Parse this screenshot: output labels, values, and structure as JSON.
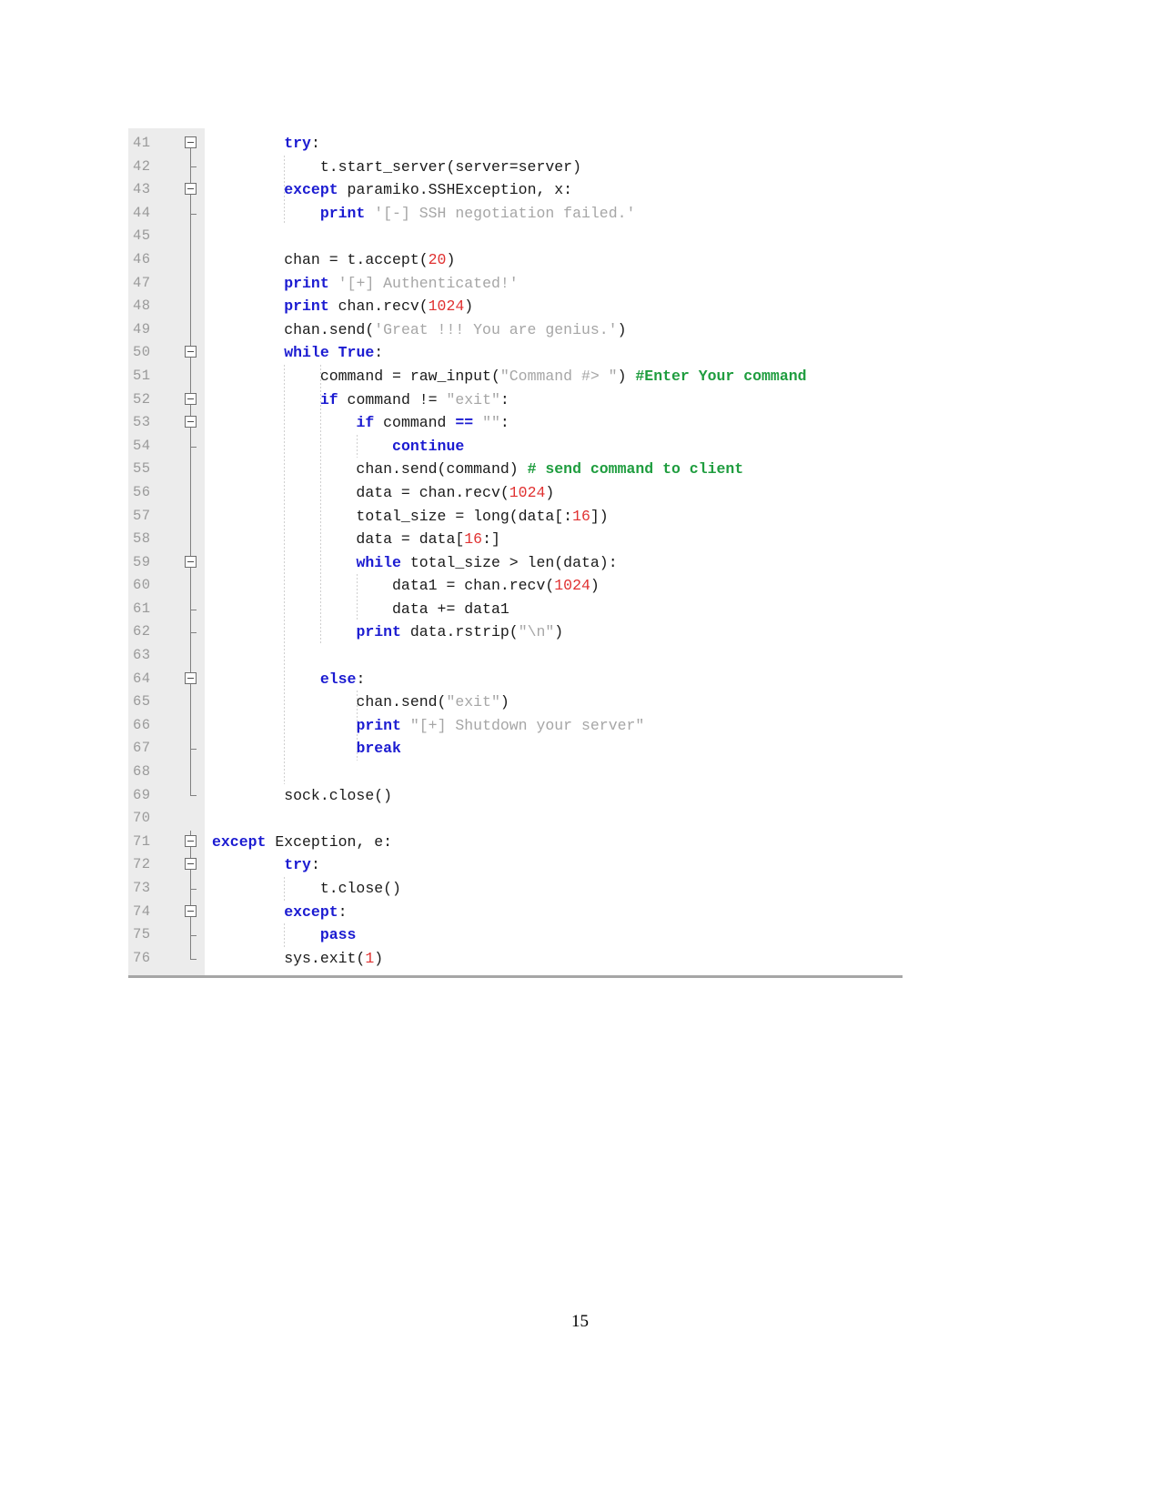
{
  "document": {
    "page_number": "15",
    "figure_name": "python-ssh-server-code-screenshot"
  },
  "editor": {
    "theme": {
      "background": "#ffffff",
      "gutter_background": "#ececec",
      "line_number_color": "#9a9a9a",
      "keyword_color": "#1b1bd1",
      "string_color": "#a6a6a6",
      "number_color": "#e03131",
      "comment_color": "#1f9d3f",
      "plain_color": "#1a1a1a",
      "fold_marker_color": "#6e6e6e"
    },
    "first_line_number": 41,
    "last_line_number": 76,
    "lines": [
      {
        "number": "41",
        "fold": "box",
        "tokens": [
          {
            "t": "        ",
            "c": "pl"
          },
          {
            "t": "try",
            "c": "kw"
          },
          {
            "t": ":",
            "c": "pl"
          }
        ]
      },
      {
        "number": "42",
        "fold": "tick",
        "tokens": [
          {
            "t": "            t.start_server(server=server)",
            "c": "pl"
          }
        ]
      },
      {
        "number": "43",
        "fold": "box",
        "tokens": [
          {
            "t": "        ",
            "c": "pl"
          },
          {
            "t": "except",
            "c": "kw"
          },
          {
            "t": " paramiko.SSHException, x:",
            "c": "pl"
          }
        ]
      },
      {
        "number": "44",
        "fold": "tick",
        "tokens": [
          {
            "t": "            ",
            "c": "pl"
          },
          {
            "t": "print",
            "c": "kw"
          },
          {
            "t": " ",
            "c": "pl"
          },
          {
            "t": "'[-] SSH negotiation failed.'",
            "c": "str"
          }
        ]
      },
      {
        "number": "45",
        "fold": "line",
        "tokens": []
      },
      {
        "number": "46",
        "fold": "line",
        "tokens": [
          {
            "t": "        chan = t.accept(",
            "c": "pl"
          },
          {
            "t": "20",
            "c": "num"
          },
          {
            "t": ")",
            "c": "pl"
          }
        ]
      },
      {
        "number": "47",
        "fold": "line",
        "tokens": [
          {
            "t": "        ",
            "c": "pl"
          },
          {
            "t": "print",
            "c": "kw"
          },
          {
            "t": " ",
            "c": "pl"
          },
          {
            "t": "'[+] Authenticated!'",
            "c": "str"
          }
        ]
      },
      {
        "number": "48",
        "fold": "line",
        "tokens": [
          {
            "t": "        ",
            "c": "pl"
          },
          {
            "t": "print",
            "c": "kw"
          },
          {
            "t": " chan.recv(",
            "c": "pl"
          },
          {
            "t": "1024",
            "c": "num"
          },
          {
            "t": ")",
            "c": "pl"
          }
        ]
      },
      {
        "number": "49",
        "fold": "line",
        "tokens": [
          {
            "t": "        chan.send(",
            "c": "pl"
          },
          {
            "t": "'Great !!! You are genius.'",
            "c": "str"
          },
          {
            "t": ")",
            "c": "pl"
          }
        ]
      },
      {
        "number": "50",
        "fold": "box",
        "tokens": [
          {
            "t": "        ",
            "c": "pl"
          },
          {
            "t": "while",
            "c": "kw"
          },
          {
            "t": " ",
            "c": "pl"
          },
          {
            "t": "True",
            "c": "kw"
          },
          {
            "t": ":",
            "c": "pl"
          }
        ]
      },
      {
        "number": "51",
        "fold": "line",
        "tokens": [
          {
            "t": "            command = raw_input(",
            "c": "pl"
          },
          {
            "t": "\"Command #> \"",
            "c": "str"
          },
          {
            "t": ") ",
            "c": "pl"
          },
          {
            "t": "#Enter Your command",
            "c": "com"
          }
        ]
      },
      {
        "number": "52",
        "fold": "box",
        "tokens": [
          {
            "t": "            ",
            "c": "pl"
          },
          {
            "t": "if",
            "c": "kw"
          },
          {
            "t": " command != ",
            "c": "pl"
          },
          {
            "t": "\"exit\"",
            "c": "str"
          },
          {
            "t": ":",
            "c": "pl"
          }
        ]
      },
      {
        "number": "53",
        "fold": "box",
        "tokens": [
          {
            "t": "                ",
            "c": "pl"
          },
          {
            "t": "if",
            "c": "kw"
          },
          {
            "t": " command ",
            "c": "pl"
          },
          {
            "t": "==",
            "c": "kw"
          },
          {
            "t": " ",
            "c": "pl"
          },
          {
            "t": "\"\"",
            "c": "str"
          },
          {
            "t": ":",
            "c": "pl"
          }
        ]
      },
      {
        "number": "54",
        "fold": "tick",
        "tokens": [
          {
            "t": "                    ",
            "c": "pl"
          },
          {
            "t": "continue",
            "c": "kw"
          }
        ]
      },
      {
        "number": "55",
        "fold": "line",
        "tokens": [
          {
            "t": "                chan.send(command) ",
            "c": "pl"
          },
          {
            "t": "# send command to client",
            "c": "com"
          }
        ]
      },
      {
        "number": "56",
        "fold": "line",
        "tokens": [
          {
            "t": "                data = chan.recv(",
            "c": "pl"
          },
          {
            "t": "1024",
            "c": "num"
          },
          {
            "t": ")",
            "c": "pl"
          }
        ]
      },
      {
        "number": "57",
        "fold": "line",
        "tokens": [
          {
            "t": "                total_size = long(data[:",
            "c": "pl"
          },
          {
            "t": "16",
            "c": "num"
          },
          {
            "t": "])",
            "c": "pl"
          }
        ]
      },
      {
        "number": "58",
        "fold": "line",
        "tokens": [
          {
            "t": "                data = data[",
            "c": "pl"
          },
          {
            "t": "16",
            "c": "num"
          },
          {
            "t": ":]",
            "c": "pl"
          }
        ]
      },
      {
        "number": "59",
        "fold": "box",
        "tokens": [
          {
            "t": "                ",
            "c": "pl"
          },
          {
            "t": "while",
            "c": "kw"
          },
          {
            "t": " total_size > len(data):",
            "c": "pl"
          }
        ]
      },
      {
        "number": "60",
        "fold": "line",
        "tokens": [
          {
            "t": "                    data1 = chan.recv(",
            "c": "pl"
          },
          {
            "t": "1024",
            "c": "num"
          },
          {
            "t": ")",
            "c": "pl"
          }
        ]
      },
      {
        "number": "61",
        "fold": "tick",
        "tokens": [
          {
            "t": "                    data += data1",
            "c": "pl"
          }
        ]
      },
      {
        "number": "62",
        "fold": "tick",
        "tokens": [
          {
            "t": "                ",
            "c": "pl"
          },
          {
            "t": "print",
            "c": "kw"
          },
          {
            "t": " data.rstrip(",
            "c": "pl"
          },
          {
            "t": "\"\\n\"",
            "c": "str"
          },
          {
            "t": ")",
            "c": "pl"
          }
        ]
      },
      {
        "number": "63",
        "fold": "line",
        "tokens": []
      },
      {
        "number": "64",
        "fold": "box",
        "tokens": [
          {
            "t": "            ",
            "c": "pl"
          },
          {
            "t": "else",
            "c": "kw"
          },
          {
            "t": ":",
            "c": "pl"
          }
        ]
      },
      {
        "number": "65",
        "fold": "line",
        "tokens": [
          {
            "t": "                chan.send(",
            "c": "pl"
          },
          {
            "t": "\"exit\"",
            "c": "str"
          },
          {
            "t": ")",
            "c": "pl"
          }
        ]
      },
      {
        "number": "66",
        "fold": "line",
        "tokens": [
          {
            "t": "                ",
            "c": "pl"
          },
          {
            "t": "print",
            "c": "kw"
          },
          {
            "t": " ",
            "c": "pl"
          },
          {
            "t": "\"[+] Shutdown your server\"",
            "c": "str"
          }
        ]
      },
      {
        "number": "67",
        "fold": "tick",
        "tokens": [
          {
            "t": "                ",
            "c": "pl"
          },
          {
            "t": "break",
            "c": "kw"
          }
        ]
      },
      {
        "number": "68",
        "fold": "line",
        "tokens": []
      },
      {
        "number": "69",
        "fold": "end",
        "tokens": [
          {
            "t": "        sock.close()",
            "c": "pl"
          }
        ]
      },
      {
        "number": "70",
        "fold": "none",
        "tokens": []
      },
      {
        "number": "71",
        "fold": "box-flush",
        "tokens": [
          {
            "t": "",
            "c": "pl"
          },
          {
            "t": "except",
            "c": "kw"
          },
          {
            "t": " Exception, e:",
            "c": "pl"
          }
        ]
      },
      {
        "number": "72",
        "fold": "box",
        "tokens": [
          {
            "t": "        ",
            "c": "pl"
          },
          {
            "t": "try",
            "c": "kw"
          },
          {
            "t": ":",
            "c": "pl"
          }
        ]
      },
      {
        "number": "73",
        "fold": "tick",
        "tokens": [
          {
            "t": "            t.close()",
            "c": "pl"
          }
        ]
      },
      {
        "number": "74",
        "fold": "box",
        "tokens": [
          {
            "t": "        ",
            "c": "pl"
          },
          {
            "t": "except",
            "c": "kw"
          },
          {
            "t": ":",
            "c": "pl"
          }
        ]
      },
      {
        "number": "75",
        "fold": "tick",
        "tokens": [
          {
            "t": "            ",
            "c": "pl"
          },
          {
            "t": "pass",
            "c": "kw"
          }
        ]
      },
      {
        "number": "76",
        "fold": "end",
        "tokens": [
          {
            "t": "        sys.exit(",
            "c": "pl"
          },
          {
            "t": "1",
            "c": "num"
          },
          {
            "t": ")",
            "c": "pl"
          }
        ]
      }
    ]
  }
}
